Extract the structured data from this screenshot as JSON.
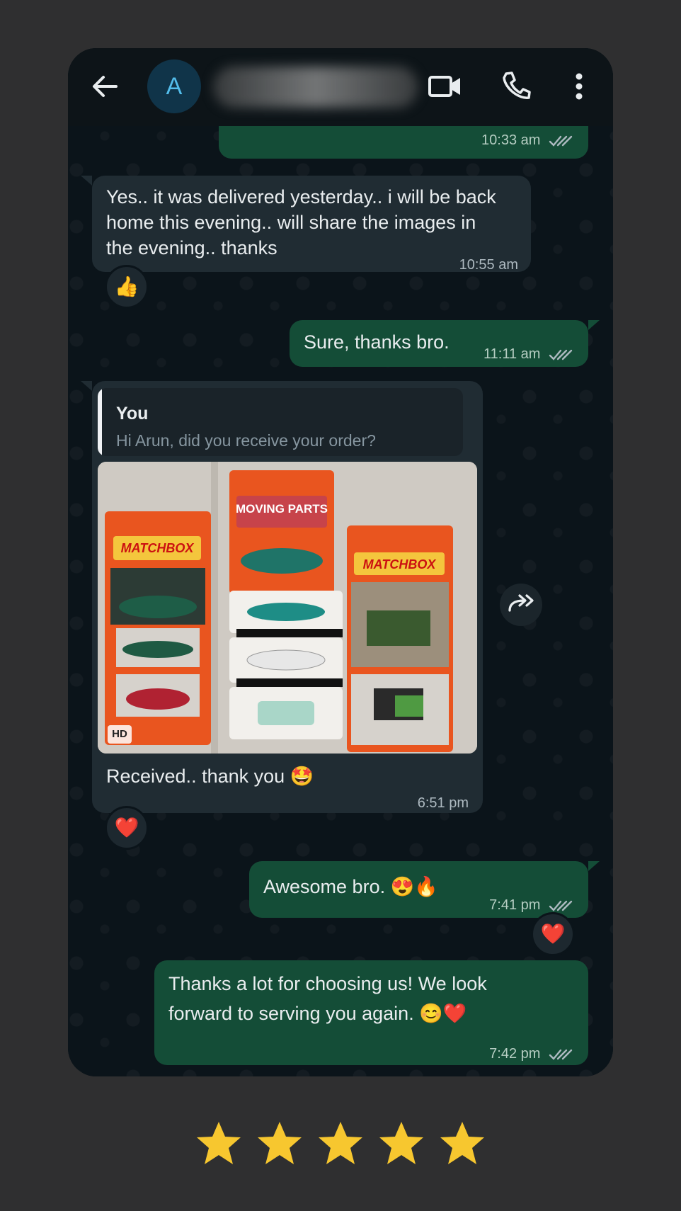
{
  "header": {
    "avatar_letter": "A",
    "contact_name": "",
    "icons": [
      "back-arrow-icon",
      "video-call-icon",
      "phone-call-icon",
      "more-options-icon"
    ]
  },
  "messages": [
    {
      "id": "m0",
      "direction": "out",
      "text": "",
      "time": "10:33 am",
      "ticks": "read"
    },
    {
      "id": "m1",
      "direction": "in",
      "text": "Yes.. it was delivered yesterday.. i will be back home this evening.. will share the images in the evening.. thanks",
      "time": "10:55 am",
      "reaction": "👍"
    },
    {
      "id": "m2",
      "direction": "out",
      "text": "Sure, thanks bro.",
      "time": "11:11 am",
      "ticks": "read"
    },
    {
      "id": "m3",
      "direction": "in",
      "reply_author": "You",
      "reply_text": "Hi Arun, did you receive your order?",
      "image_badge": "HD",
      "image_brand": "MATCHBOX",
      "image_brand_2": "MOVING PARTS",
      "text": "Received.. thank you 🤩",
      "time": "6:51 pm",
      "reaction": "❤️"
    },
    {
      "id": "m4",
      "direction": "out",
      "text": "Awesome bro. 😍🔥",
      "time": "7:41 pm",
      "ticks": "read",
      "reaction": "❤️"
    },
    {
      "id": "m5",
      "direction": "out",
      "text": "Thanks a lot for choosing us! We look forward to serving you again. 😊❤️",
      "time": "7:42 pm",
      "ticks": "read"
    }
  ],
  "rating": {
    "stars": 5,
    "max": 5
  },
  "colors": {
    "background": "#2f2f30",
    "chat_background": "#0b141a",
    "incoming_bubble": "#202c33",
    "outgoing_bubble": "#144d37",
    "star": "#f7c72f",
    "read_ticks": "#aebac1"
  }
}
